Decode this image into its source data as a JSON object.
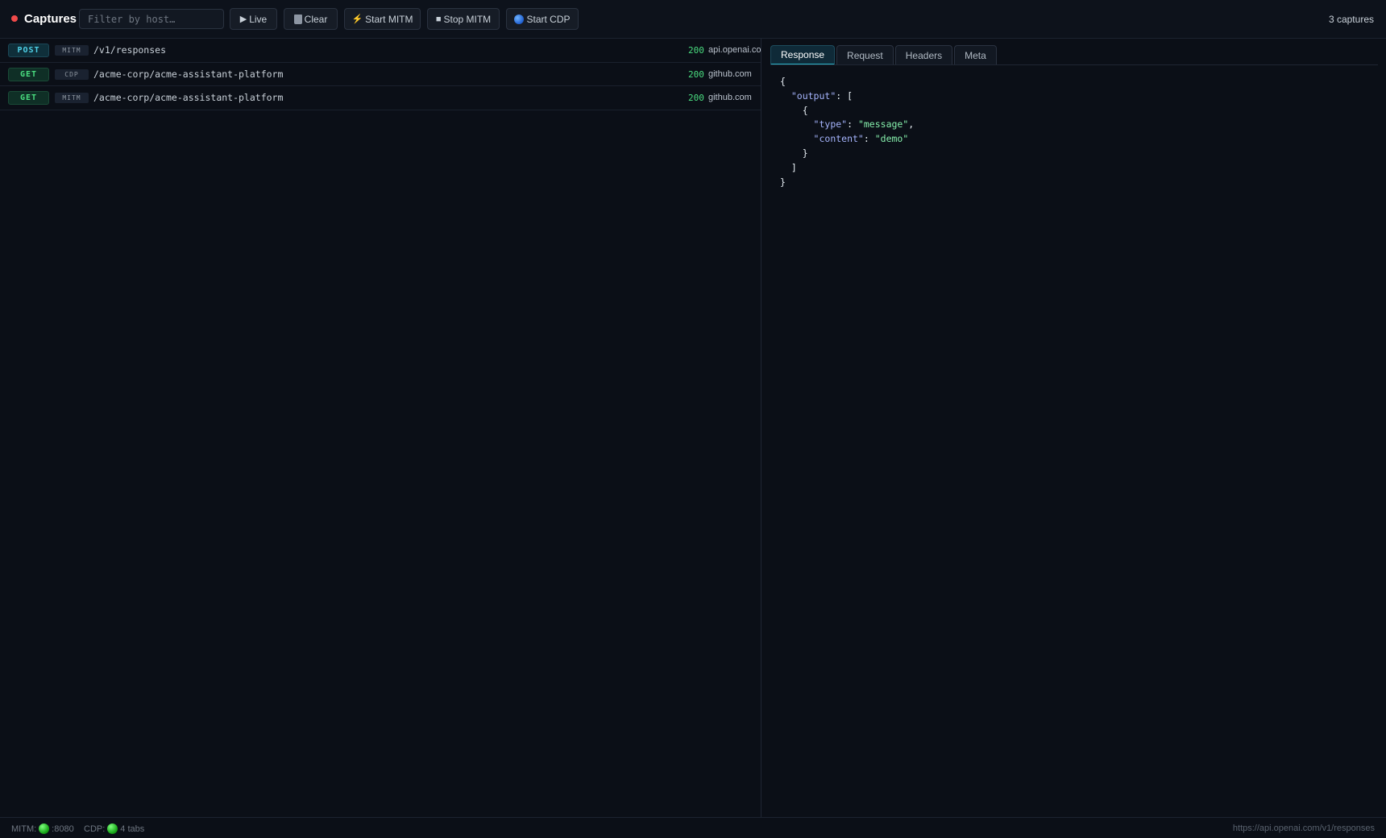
{
  "toolbar": {
    "title": "Captures",
    "filter_placeholder": "Filter by host…",
    "live_label": "Live",
    "clear_label": "Clear",
    "start_mitm_label": "Start MITM",
    "stop_mitm_label": "Stop MITM",
    "start_cdp_label": "Start CDP",
    "capture_count": "3 captures",
    "icons": [
      "record-dot-icon",
      "play-icon",
      "trash-icon",
      "bolt-icon",
      "stop-icon",
      "globe-icon"
    ]
  },
  "captures": [
    {
      "method": "POST",
      "source": "MITM",
      "path": "/v1/responses",
      "status": "200",
      "host": "api.openai.com"
    },
    {
      "method": "GET",
      "source": "CDP",
      "path": "/acme-corp/acme-assistant-platform",
      "status": "200",
      "host": "github.com"
    },
    {
      "method": "GET",
      "source": "MITM",
      "path": "/acme-corp/acme-assistant-platform",
      "status": "200",
      "host": "github.com"
    }
  ],
  "detail": {
    "tabs": [
      "Response",
      "Request",
      "Headers",
      "Meta"
    ],
    "active_tab": "Response",
    "json_lines": {
      "l1": "{",
      "k_output": "\"output\"",
      "k_type": "\"type\"",
      "v_type": "\"message\"",
      "k_content": "\"content\"",
      "v_content": "\"demo\""
    }
  },
  "footer": {
    "mitm_label": "MITM:",
    "mitm_value": ":8080",
    "cdp_label": "CDP:",
    "cdp_value": "4 tabs",
    "url": "https://api.openai.com/v1/responses"
  },
  "colors": {
    "background": "#0b0f17",
    "record": "#f04a4a",
    "status_ok": "#4ade80",
    "post_badge": "#4fd1e8",
    "get_badge": "#4ade80",
    "json_key": "#a5b4fc",
    "json_string": "#86efac"
  }
}
